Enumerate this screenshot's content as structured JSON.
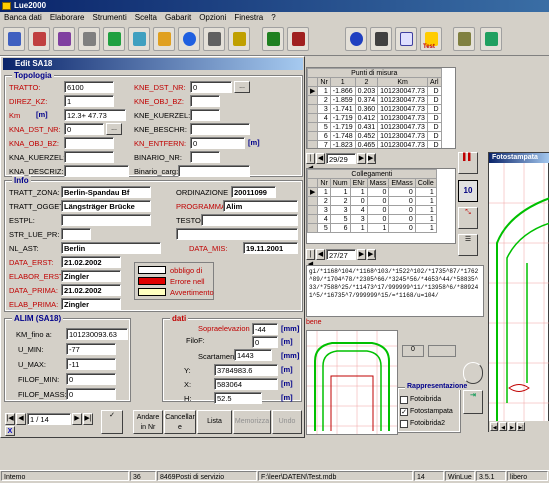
{
  "app": {
    "title": "Lue2000"
  },
  "menu": [
    "Banca dati",
    "Elaborare",
    "Strumenti",
    "Scelta",
    "Gabarit",
    "Opzioni",
    "Finestra",
    "?"
  ],
  "toolbar": {
    "icons": [
      "report-icon",
      "print-icon",
      "bookmark-icon",
      "disk-icon",
      "recycle-icon",
      "edit-icon",
      "grid-icon",
      "lue-icon",
      "hdd-icon",
      "train-icon",
      "vehicle-icon",
      "plug-icon",
      "navigate-icon",
      "measure-icon",
      "formula-icon",
      "test-icon",
      "tools-icon",
      "exit-icon"
    ],
    "test_label": "Test"
  },
  "dialog": {
    "title": "Edit SA18",
    "topologia": {
      "label": "Topologia",
      "trattto_label": "TRATTO:",
      "trattto": "6100",
      "direz_label": "DIREZ_KZ:",
      "direz": "1",
      "km_label": "Km",
      "km_unit": "[m]",
      "km": "12.3+ 47.73",
      "kna_dst_nr_label": "KNA_DST_NR:",
      "kna_dst_nr": "0",
      "kna_obj_bz_label": "KNA_OBJ_BZ:",
      "kna_kuerzel_label": "KNA_KUERZEL:",
      "kna_descriz_label": "KNA_DESCRIZ:",
      "kne_dst_nr_label": "KNE_DST_NR:",
      "kne_dst_nr": "0",
      "kne_obj_bz_label": "KNE_OBJ_BZ:",
      "kne_kuerzel_label": "KNE_KUERZEL:",
      "kne_beschr_label": "KNE_BESCHR:",
      "kn_entfern_label": "KN_ENTFERN:",
      "kn_entfern": "0",
      "kn_unit": "[m]",
      "binario_nr_label": "BINARIO_NR:",
      "binario_carg_label": "Binario_carg:"
    },
    "info": {
      "label": "Info",
      "tratt_zona_label": "TRATT_ZONA:",
      "tratt_zona": "Berlin-Spandau Bf",
      "tratt_ogget_label": "TRATT_OGGET",
      "tratt_ogget": "Längsträger Brücke",
      "estpl_label": "ESTPL:",
      "str_lue_pr_label": "STR_LUE_PR:",
      "nl_ast_label": "NL_AST:",
      "nl_ast": "Berlin",
      "data_erst_label": "DATA_ERST:",
      "data_erst": "21.02.2002",
      "elabor_erst_label": "ELABOR_ERST:",
      "elabor_erst": "Zingler",
      "data_prima_label": "DATA_PRIMA:",
      "data_prima": "21.02.2002",
      "elab_prima_label": "ELAB_PRIMA:",
      "elab_prima": "Zingler",
      "ordinazione_label": "ORDINAZIONE",
      "ordinazione": "20011099",
      "programma_label": "PROGRAMMA",
      "programma": "Alim",
      "testo_label": "TESTO",
      "data_mis_label": "DATA_MIS:",
      "data_mis": "19.11.2001",
      "legend": [
        {
          "text": "obbligo di",
          "color": "#ffffff"
        },
        {
          "text": "Errore nell",
          "color": "#e00000"
        },
        {
          "text": "Avvertimento",
          "color": "#ffffc0"
        }
      ]
    },
    "alim": {
      "label": "ALIM (SA18)",
      "km_fino_label": "KM_fino a:",
      "km_fino": "101230093.63",
      "u_min_label": "U_MIN:",
      "u_min": "-77",
      "u_max_label": "U_MAX:",
      "u_max": "-11",
      "filof_min_label": "FILOF_MIN:",
      "filof_min": "0",
      "filof_mass_label": "FILOF_MASS:",
      "filof_mass": "0"
    },
    "dati": {
      "label": "dati",
      "sopraelev_label": "Sopraelevazion",
      "sopraelev": "-44",
      "sopraelev_unit": "[mm]",
      "filof_label": "FiloF:",
      "filof": "0",
      "filof_unit": "[m]",
      "scartamento_label": "Scartament",
      "scartamento": "1443",
      "scartamento_unit": "[mm]",
      "y_label": "Y:",
      "y": "3784983.6",
      "y_unit": "[m]",
      "x_label": "X:",
      "x": "583064",
      "x_unit": "[m]",
      "h_label": "H:",
      "h": "52.5",
      "h_unit": "[m]"
    },
    "nav": {
      "record": "1 / 14"
    },
    "buttons": {
      "andare": "Andare in Nr",
      "cancellare": "Cancellar e",
      "lista": "Lista",
      "memorizza": "Memorizza",
      "undo": "Undo"
    }
  },
  "punti": {
    "title": "Punti di misura",
    "headers": [
      "Nr",
      "1",
      "2",
      "Km",
      "Arl"
    ],
    "rows": [
      [
        "1",
        "-1.866",
        "0.203",
        "101230047.73",
        "D"
      ],
      [
        "2",
        "-1.859",
        "0.374",
        "101230047.73",
        "D"
      ],
      [
        "3",
        "-1.741",
        "0.360",
        "101230047.73",
        "D"
      ],
      [
        "4",
        "-1.719",
        "0.412",
        "101230047.73",
        "D"
      ],
      [
        "5",
        "-1.719",
        "0.431",
        "101230047.73",
        "D"
      ],
      [
        "6",
        "-1.748",
        "0.452",
        "101230047.73",
        "D"
      ],
      [
        "7",
        "-1.823",
        "0.465",
        "101230047.73",
        "D"
      ]
    ],
    "nav": "29/29"
  },
  "collegamenti": {
    "title": "Collegamenti",
    "headers": [
      "Nr",
      "Num",
      "ENr",
      "Mass",
      "EMass",
      "Colle"
    ],
    "rows": [
      [
        "1",
        "1",
        "1",
        "0",
        "0",
        "1"
      ],
      [
        "2",
        "2",
        "0",
        "0",
        "0",
        "1"
      ],
      [
        "3",
        "3",
        "4",
        "0",
        "0",
        "1"
      ],
      [
        "4",
        "5",
        "3",
        "0",
        "0",
        "1"
      ],
      [
        "5",
        "6",
        "1",
        "1",
        "0",
        "1"
      ]
    ],
    "nav": "27/27"
  },
  "gabarit_text": "gi/*1168^104/*1168^103/*1522^102/*1735^87/*1762^89/*1704^78/*2305^66/*3245^56/*4653^44/*58835^33/*7588^25/*11473^17/999999^11/*13958^6/*889241^5/*16735^7/999999^15/=*1168/u=104/",
  "bene": "bene",
  "display_value": "0",
  "rappresentazione": {
    "label": "Rappresentazione",
    "items": [
      {
        "label": "Fotoibrida",
        "checked": false
      },
      {
        "label": "Fotostampata",
        "checked": true
      },
      {
        "label": "Fotoibrida2",
        "checked": false
      }
    ]
  },
  "fotostampata": {
    "title": "Fotostampata"
  },
  "status": {
    "mode": "Intemo",
    "n1": "36",
    "db": "8469Posti di servizio",
    "path": "F:\\leer\\DATEN\\Test.mdb",
    "n2": "14",
    "version_label": "WinLue",
    "version": "3.5.1",
    "state": "libero"
  },
  "colors": {
    "title_bar": "#0a246a",
    "grid_green": "#00c000",
    "accent_red": "#c00000"
  }
}
